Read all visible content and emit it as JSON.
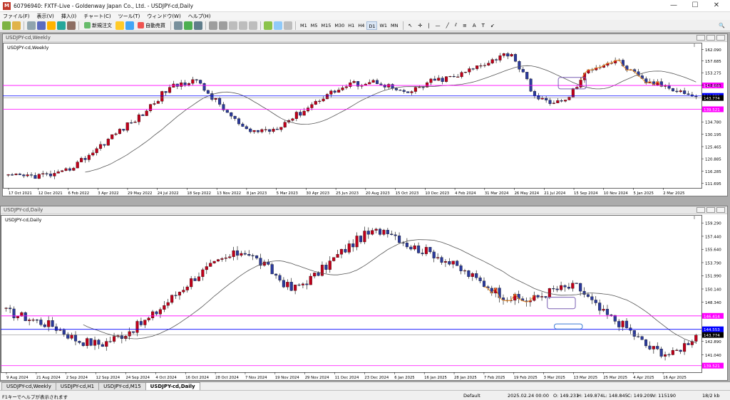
{
  "window": {
    "title": "60796940: FXTF-Live - Goldenway Japan Co., Ltd. - USDJPY-cd,Daily"
  },
  "menu": [
    "ファイル(F)",
    "表示(V)",
    "挿入(I)",
    "チャート(C)",
    "ツール(T)",
    "ウィンドウ(W)",
    "ヘルプ(H)"
  ],
  "toolbar": {
    "new_order": "新規注文",
    "auto_trade": "自動売買",
    "timeframes": [
      "M1",
      "M5",
      "M15",
      "M30",
      "H1",
      "H4",
      "D1",
      "W1",
      "MN"
    ],
    "active_timeframe": "D1"
  },
  "weekly": {
    "title": "USDJPY-cd,Weekly",
    "label": "USDJPY-cd,Weekly",
    "price_ticks": [
      "162.090",
      "157.685",
      "153.275",
      "148.685",
      "144.553",
      "143.774",
      "139.521",
      "134.780",
      "130.195",
      "125.465",
      "120.885",
      "116.285",
      "111.695"
    ],
    "date_ticks": [
      "17 Oct 2021",
      "12 Dec 2021",
      "6 Feb 2022",
      "3 Apr 2022",
      "29 May 2022",
      "24 Jul 2022",
      "18 Sep 2022",
      "13 Nov 2022",
      "8 Jan 2023",
      "5 Mar 2023",
      "30 Apr 2023",
      "25 Jun 2023",
      "20 Aug 2023",
      "15 Oct 2023",
      "10 Dec 2023",
      "4 Feb 2024",
      "31 Mar 2024",
      "26 May 2024",
      "21 Jul 2024",
      "15 Sep 2024",
      "10 Nov 2024",
      "5 Jan 2025",
      "2 Mar 2025"
    ],
    "hlines": [
      {
        "price": "148.484",
        "color": "#ff00ff"
      },
      {
        "price": "144.553",
        "color": "#0000ff"
      },
      {
        "price": "139.521",
        "color": "#ff00ff"
      }
    ]
  },
  "daily": {
    "title": "USDJPY-cd,Daily",
    "label": "USDJPY-cd,Daily",
    "price_ticks": [
      "159.290",
      "157.440",
      "155.640",
      "153.790",
      "151.990",
      "150.140",
      "148.340",
      "146.414",
      "144.553",
      "143.774",
      "142.890",
      "141.040",
      "139.521"
    ],
    "date_ticks": [
      "9 Aug 2024",
      "21 Aug 2024",
      "2 Sep 2024",
      "12 Sep 2024",
      "24 Sep 2024",
      "4 Oct 2024",
      "16 Oct 2024",
      "28 Oct 2024",
      "7 Nov 2024",
      "19 Nov 2024",
      "29 Nov 2024",
      "11 Dec 2024",
      "23 Dec 2024",
      "6 Jan 2025",
      "16 Jan 2025",
      "28 Jan 2025",
      "7 Feb 2025",
      "19 Feb 2025",
      "3 Mar 2025",
      "13 Mar 2025",
      "25 Mar 2025",
      "4 Apr 2025",
      "16 Apr 2025"
    ],
    "hlines": [
      {
        "price": "146.414",
        "color": "#ff00ff"
      },
      {
        "price": "144.553",
        "color": "#0000ff"
      },
      {
        "price": "139.521",
        "color": "#ff00ff"
      }
    ]
  },
  "tabs": [
    "USDJPY-cd,Weekly",
    "USDJPY-cd,H1",
    "USDJPY-cd,M15",
    "USDJPY-cd,Daily"
  ],
  "active_tab": "USDJPY-cd,Daily",
  "status": {
    "help": "F1キーでヘルプが表示されます",
    "profile": "Default",
    "datetime": "2025.02.24 00:00",
    "open": "O: 149.231",
    "high": "H: 149.874",
    "low": "L: 148.845",
    "close": "C: 149.209",
    "volume": "V: 115190",
    "traffic": "18/2 kb"
  },
  "colors": {
    "bull": "#c0001a",
    "bear": "#2b3a9c",
    "ma": "#555555",
    "magenta": "#ff00ff",
    "blue_line": "#0000ff",
    "orange": "#f08c1e"
  }
}
